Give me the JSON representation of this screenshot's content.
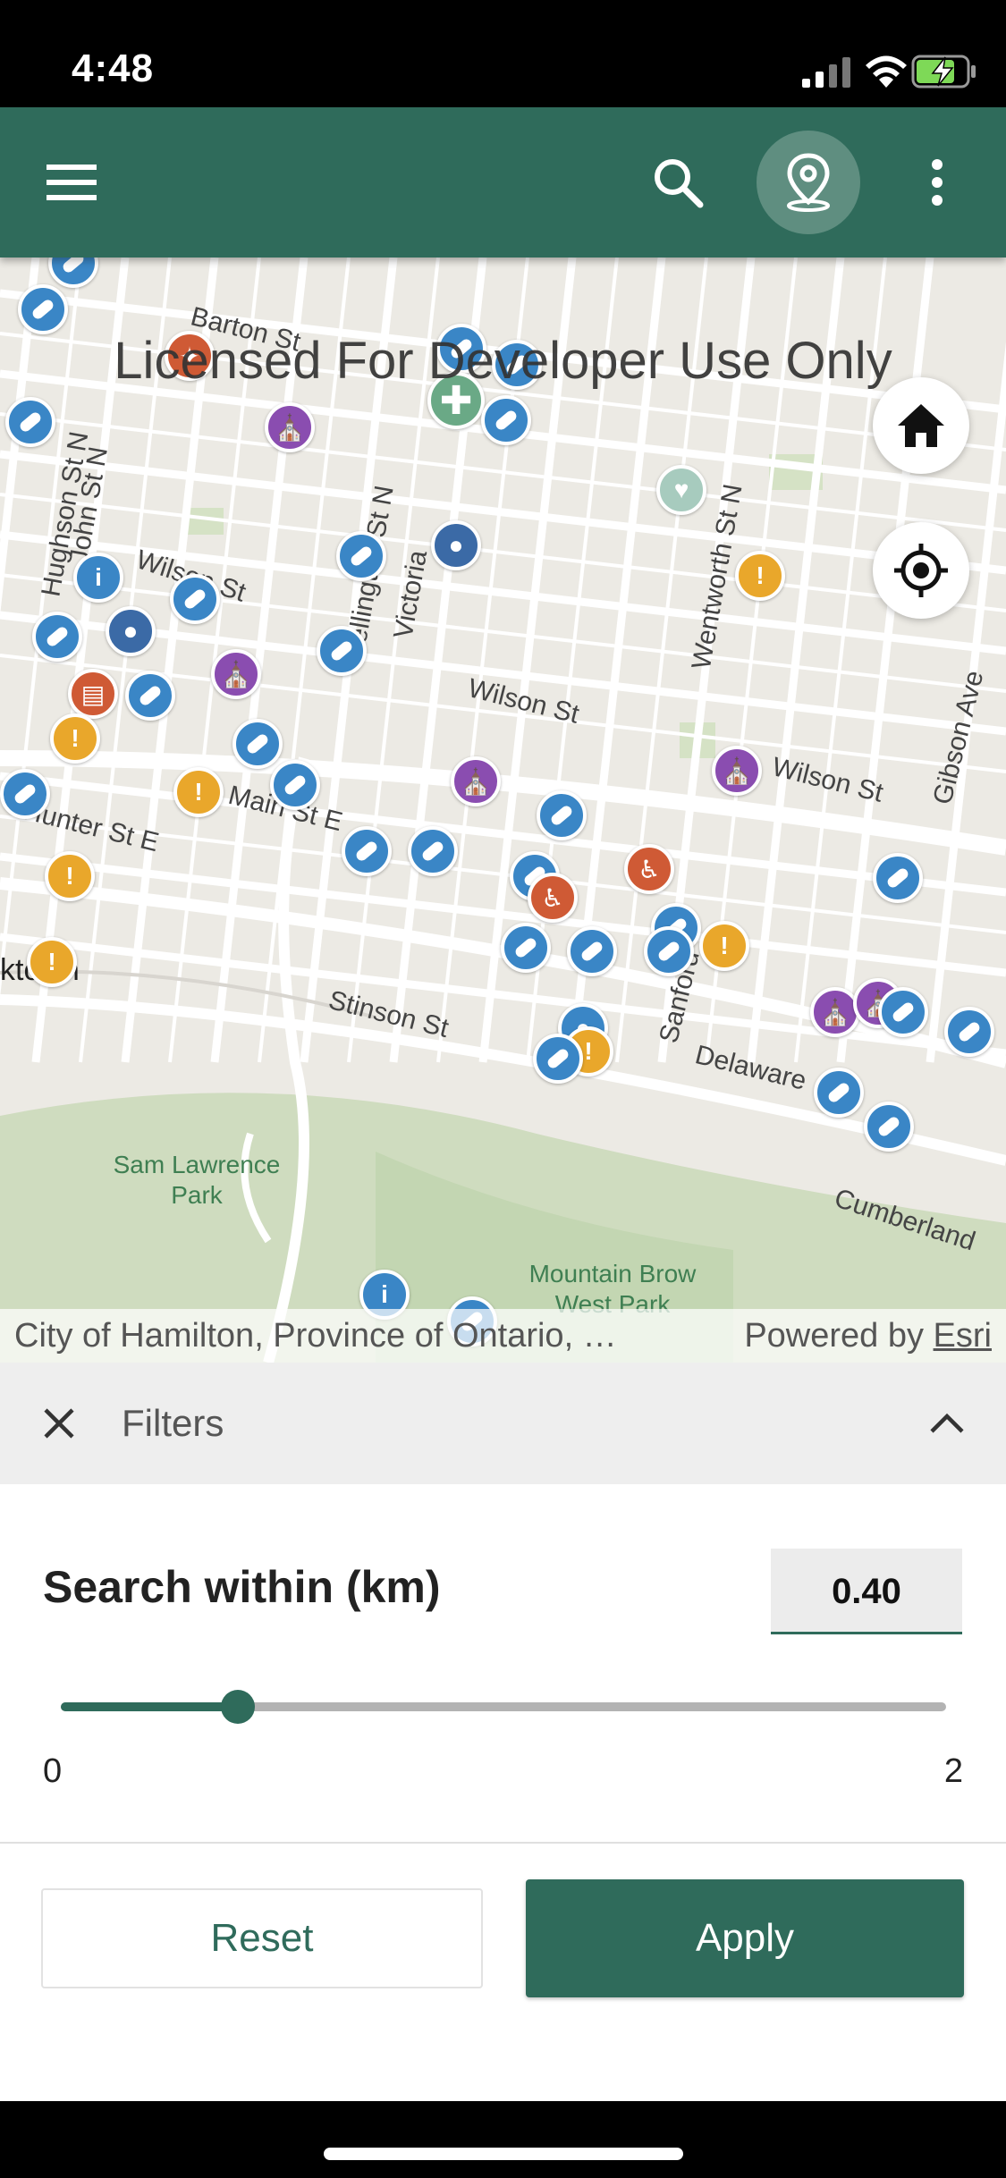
{
  "status_bar": {
    "time": "4:48",
    "icons": [
      "cellular-signal-icon",
      "wifi-icon",
      "battery-charging-icon"
    ]
  },
  "app_bar": {
    "color": "#2f6b5b",
    "icons": [
      "menu-icon",
      "search-icon",
      "location-pin-icon",
      "more-vertical-icon"
    ]
  },
  "map": {
    "watermark": "Licensed For Developer Use Only",
    "attribution": "City of Hamilton, Province of Ontario, …",
    "powered_by": "Powered by",
    "esri_link": "Esri",
    "streets": [
      "Barton St",
      "Hughson St N",
      "John St N",
      "Wilson St",
      "Wellington St N",
      "Victoria",
      "Wentworth St N",
      "Wilson St",
      "Wilson St",
      "Gibson Ave",
      "Main St E",
      "Hunter St E",
      "Stinson St",
      "Sanford",
      "Delaware",
      "Cumberland",
      "ktown"
    ],
    "parks": [
      "Sam Lawrence Park",
      "Mountain Brow West Park"
    ],
    "controls": [
      "home-icon",
      "gps-crosshair-icon"
    ]
  },
  "filters": {
    "title": "Filters",
    "search_within_label": "Search within (km)",
    "search_within_value": "0.40",
    "slider_min": "0",
    "slider_max": "2",
    "slider_value": 0.4,
    "slider_max_value": 2,
    "reset_label": "Reset",
    "apply_label": "Apply",
    "accent": "#2f6b5b"
  }
}
